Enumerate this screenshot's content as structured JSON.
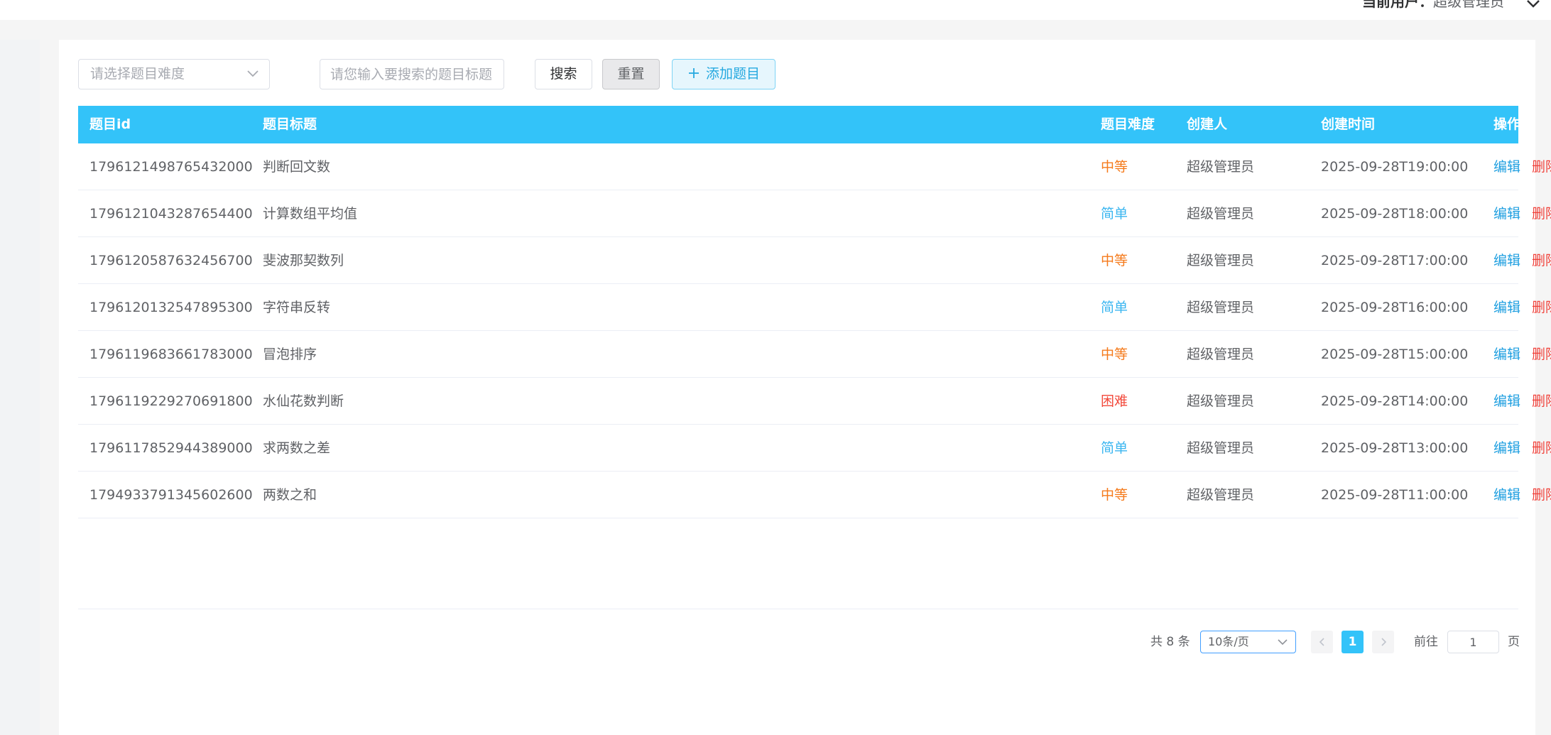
{
  "header": {
    "current_user_label": "当前用户：",
    "current_user_name": "超级管理员"
  },
  "filters": {
    "difficulty_placeholder": "请选择题目难度",
    "title_placeholder": "请您输入要搜索的题目标题",
    "search_label": "搜索",
    "reset_label": "重置",
    "add_label": "添加题目"
  },
  "table": {
    "columns": {
      "id": "题目id",
      "title": "题目标题",
      "difficulty": "题目难度",
      "creator": "创建人",
      "created_at": "创建时间",
      "actions": "操作"
    },
    "rows": [
      {
        "id": "1796121498765432000",
        "title": "判断回文数",
        "difficulty": "中等",
        "level": "medium",
        "creator": "超级管理员",
        "created_at": "2025-09-28T19:00:00"
      },
      {
        "id": "1796121043287654400",
        "title": "计算数组平均值",
        "difficulty": "简单",
        "level": "easy",
        "creator": "超级管理员",
        "created_at": "2025-09-28T18:00:00"
      },
      {
        "id": "1796120587632456700",
        "title": "斐波那契数列",
        "difficulty": "中等",
        "level": "medium",
        "creator": "超级管理员",
        "created_at": "2025-09-28T17:00:00"
      },
      {
        "id": "1796120132547895300",
        "title": "字符串反转",
        "difficulty": "简单",
        "level": "easy",
        "creator": "超级管理员",
        "created_at": "2025-09-28T16:00:00"
      },
      {
        "id": "1796119683661783000",
        "title": "冒泡排序",
        "difficulty": "中等",
        "level": "medium",
        "creator": "超级管理员",
        "created_at": "2025-09-28T15:00:00"
      },
      {
        "id": "1796119229270691800",
        "title": "水仙花数判断",
        "difficulty": "困难",
        "level": "hard",
        "creator": "超级管理员",
        "created_at": "2025-09-28T14:00:00"
      },
      {
        "id": "1796117852944389000",
        "title": "求两数之差",
        "difficulty": "简单",
        "level": "easy",
        "creator": "超级管理员",
        "created_at": "2025-09-28T13:00:00"
      },
      {
        "id": "1794933791345602600",
        "title": "两数之和",
        "difficulty": "中等",
        "level": "medium",
        "creator": "超级管理员",
        "created_at": "2025-09-28T11:00:00"
      }
    ],
    "edit_label": "编辑",
    "delete_label": "删除"
  },
  "pagination": {
    "total_text": "共 8 条",
    "page_size": "10条/页",
    "current_page": "1",
    "goto_label": "前往",
    "goto_value": "1",
    "page_suffix": "页"
  },
  "colors": {
    "accent": "#33c3f9",
    "medium": "#f57a1b",
    "easy": "#3bb6f0",
    "hard": "#f24a3c",
    "edit": "#1f9fe0",
    "delete": "#f0413a"
  }
}
